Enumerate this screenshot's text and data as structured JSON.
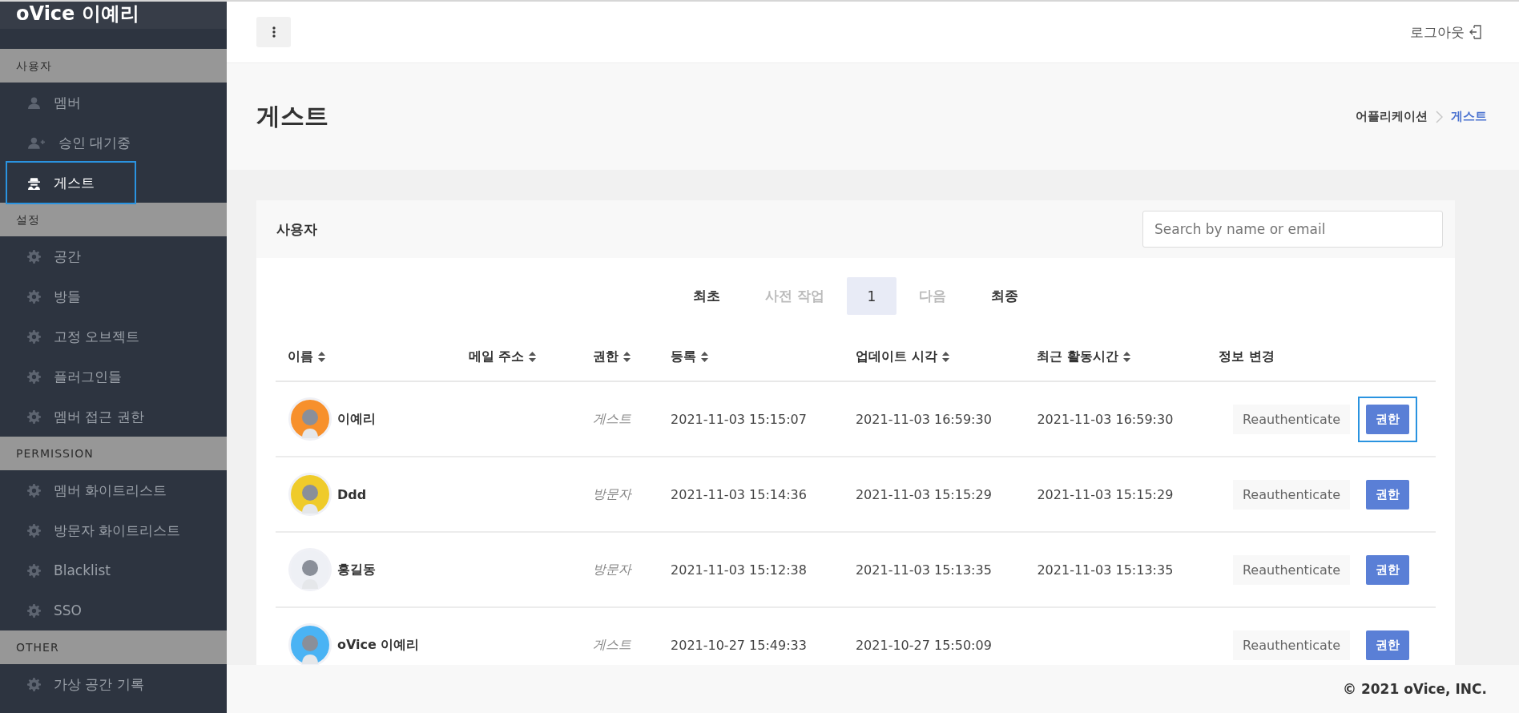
{
  "sidebar": {
    "brand": "oVice 이예리",
    "sections": [
      {
        "title": "사용자",
        "items": [
          {
            "label": "멤버",
            "kind": "user",
            "selected": false
          },
          {
            "label": "승인 대기중",
            "kind": "pending",
            "selected": false
          },
          {
            "label": "게스트",
            "kind": "guest",
            "selected": true
          }
        ]
      },
      {
        "title": "설정",
        "items": [
          {
            "label": "공간",
            "kind": "setting",
            "selected": false
          },
          {
            "label": "방들",
            "kind": "setting",
            "selected": false
          },
          {
            "label": "고정 오브젝트",
            "kind": "setting",
            "selected": false
          },
          {
            "label": "플러그인들",
            "kind": "setting",
            "selected": false
          },
          {
            "label": "멤버 접근 권한",
            "kind": "setting",
            "selected": false
          }
        ]
      },
      {
        "title": "PERMISSION",
        "items": [
          {
            "label": "멤버 화이트리스트",
            "kind": "setting",
            "selected": false
          },
          {
            "label": "방문자 화이트리스트",
            "kind": "setting",
            "selected": false
          },
          {
            "label": "Blacklist",
            "kind": "setting",
            "selected": false
          },
          {
            "label": "SSO",
            "kind": "setting",
            "selected": false
          }
        ]
      },
      {
        "title": "OTHER",
        "items": [
          {
            "label": "가상 공간 기록",
            "kind": "setting",
            "selected": false
          }
        ]
      }
    ]
  },
  "header": {
    "logout": "로그아웃"
  },
  "page": {
    "title": "게스트",
    "breadcrumb": [
      {
        "label": "어플리케이션",
        "selected": false
      },
      {
        "label": "게스트",
        "selected": true
      }
    ]
  },
  "card": {
    "title": "사용자",
    "search": {
      "placeholder": "Search by name or email"
    },
    "pagination": [
      {
        "label": "최초",
        "selected": false,
        "disabled": false
      },
      {
        "label": "사전 작업",
        "selected": false,
        "disabled": true
      },
      {
        "label": "1",
        "selected": true,
        "disabled": false
      },
      {
        "label": "다음",
        "selected": false,
        "disabled": true
      },
      {
        "label": "최종",
        "selected": false,
        "disabled": false
      }
    ],
    "table": {
      "columns": [
        {
          "label": "이름",
          "sortable": true
        },
        {
          "label": "메일 주소",
          "sortable": true
        },
        {
          "label": "권한",
          "sortable": true
        },
        {
          "label": "등록",
          "sortable": true
        },
        {
          "label": "업데이트 시각",
          "sortable": true
        },
        {
          "label": "최근 활동시간",
          "sortable": true
        },
        {
          "label": "정보 변경",
          "sortable": false
        }
      ],
      "rows": [
        {
          "name": "이예리",
          "color": "#f7902c",
          "role": "게스트",
          "registered": "2021-11-03 15:15:07",
          "updated": "2021-11-03 16:59:30",
          "last_active": "2021-11-03 16:59:30",
          "reauth": "Reauthenticate",
          "permission": "권한",
          "highlighted": true
        },
        {
          "name": "Ddd",
          "color": "#efcb2a",
          "role": "방문자",
          "registered": "2021-11-03 15:14:36",
          "updated": "2021-11-03 15:15:29",
          "last_active": "2021-11-03 15:15:29",
          "reauth": "Reauthenticate",
          "permission": "권한",
          "highlighted": false
        },
        {
          "name": "홍길동",
          "color": "#eef0f5",
          "role": "방문자",
          "registered": "2021-11-03 15:12:38",
          "updated": "2021-11-03 15:13:35",
          "last_active": "2021-11-03 15:13:35",
          "reauth": "Reauthenticate",
          "permission": "권한",
          "highlighted": false
        },
        {
          "name": "oVice 이예리",
          "color": "#4ab3f4",
          "role": "게스트",
          "registered": "2021-10-27 15:49:33",
          "updated": "2021-10-27 15:50:09",
          "reauth": "Reauthenticate",
          "permission": "권한",
          "highlighted": false
        }
      ]
    }
  },
  "footer": "© 2021 oVice, INC."
}
